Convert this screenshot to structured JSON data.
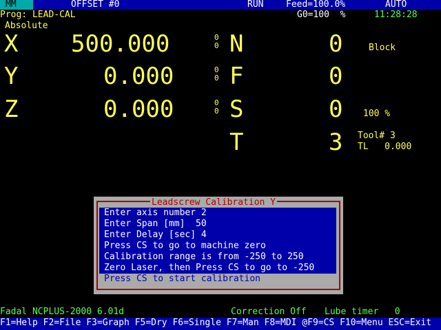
{
  "top_bar": {
    "mode": "MM",
    "offset": "OFFSET #0",
    "run_state": "RUN",
    "feed": "Feed=100.0%",
    "auto": "AUTO"
  },
  "header": {
    "program": "Prog: LEAD-CAL",
    "g0": "G0=100  %",
    "clock": "11:28:28",
    "coord_mode": "Absolute"
  },
  "axes": [
    {
      "label": "X",
      "value": "500.000",
      "sub": [
        "0",
        "0"
      ]
    },
    {
      "label": "Y",
      "value": "0.000",
      "sub": [
        "0",
        "0"
      ]
    },
    {
      "label": "Z",
      "value": "0.000",
      "sub": [
        "0",
        "0"
      ]
    }
  ],
  "codes": [
    {
      "label": "N",
      "value": "0"
    },
    {
      "label": "F",
      "value": "0"
    },
    {
      "label": "S",
      "value": "0"
    },
    {
      "label": "T",
      "value": "3"
    }
  ],
  "right_info": {
    "block": "Block",
    "spindle_pct": "100 %",
    "tool": "Tool# 3",
    "tl": "TL   0.000"
  },
  "dialog": {
    "title": "Leadscrew Calibration Y",
    "lines": [
      "Enter axis number 2",
      "Enter Span [mm]  50",
      "Enter Delay [sec] 4",
      "Press CS to go to machine zero",
      "Calibration range is from -250 to 250",
      "Zero Laser, then Press CS to go to -250"
    ],
    "prompt": "Press CS to start calibration"
  },
  "status": {
    "version": "Fadal NCPLUS-2000 6.01d",
    "correction": "Correction Off",
    "lube": "Lube timer   0"
  },
  "function_keys": "F1=Help F2=File F3=Graph F5=Dry F6=Single F7=Man F8=MDI @F9=CS F10=Menu ESC=Exit",
  "colors": {
    "background": "#000000",
    "bar": "#0000aa",
    "text_yellow": "#ffff55",
    "text_green": "#55ff55",
    "dialog_border": "#aa0000",
    "dialog_frame": "#aaaaaa"
  }
}
